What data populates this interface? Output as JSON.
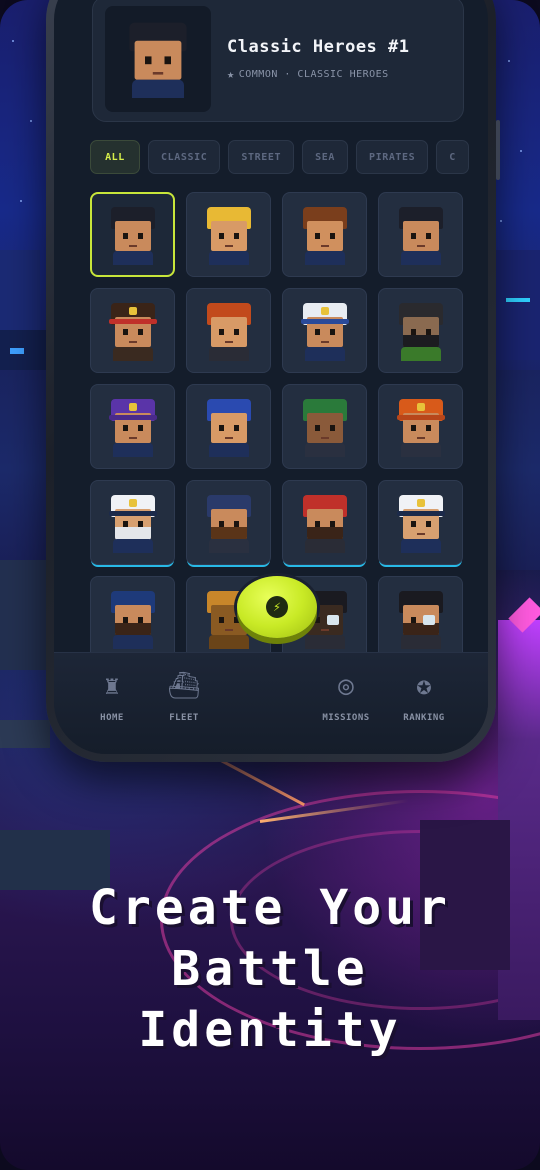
{
  "hero": {
    "title": "Classic Heroes #1",
    "subtitle": "COMMON · CLASSIC HEROES",
    "star_icon": "star-icon"
  },
  "tabs": [
    {
      "label": "ALL",
      "active": true
    },
    {
      "label": "CLASSIC",
      "active": false
    },
    {
      "label": "STREET",
      "active": false
    },
    {
      "label": "SEA",
      "active": false
    },
    {
      "label": "PIRATES",
      "active": false
    },
    {
      "label": "C",
      "active": false
    }
  ],
  "avatars": [
    {
      "name": "avatar-black-hair",
      "hair": "#1c1f2a",
      "skin": "#c98a5c",
      "body": "#1e2f5a",
      "selected": true
    },
    {
      "name": "avatar-blonde",
      "hair": "#e8b934",
      "skin": "#d89a66",
      "body": "#1e2f5a"
    },
    {
      "name": "avatar-brown-hair",
      "hair": "#7a3e1c",
      "skin": "#d0905e",
      "body": "#1e2f5a"
    },
    {
      "name": "avatar-dark-hair",
      "hair": "#1c1f2a",
      "skin": "#c98a5c",
      "body": "#1e2f5a"
    },
    {
      "name": "avatar-red-headband",
      "hair": "#3a2418",
      "skin": "#c98a5c",
      "body": "#3a2a20",
      "brim": "#c0302a"
    },
    {
      "name": "avatar-redhead",
      "hair": "#c24a1c",
      "skin": "#d89a66",
      "body": "#2a2c36"
    },
    {
      "name": "avatar-white-cap",
      "hair": "#e8ecf2",
      "skin": "#c98a5c",
      "body": "#1e2f5a",
      "brim": "#2a4a9a"
    },
    {
      "name": "avatar-masked",
      "hair": "#2a2a2e",
      "skin": "#8a6a50",
      "body": "#3a7a2a",
      "beard": "#1c1c20"
    },
    {
      "name": "avatar-purple-cap",
      "hair": "#5a34a8",
      "skin": "#c98a5c",
      "body": "#1e2f5a",
      "brim": "#4a2a8a"
    },
    {
      "name": "avatar-blue-hair",
      "hair": "#2a4ab0",
      "skin": "#d89a66",
      "body": "#1e2f5a"
    },
    {
      "name": "avatar-green-beanie",
      "hair": "#2a7a3a",
      "skin": "#8a5a3a",
      "body": "#2a3040"
    },
    {
      "name": "avatar-orange-hat",
      "hair": "#d85a1a",
      "skin": "#c98a5c",
      "body": "#2a3040",
      "brim": "#b8461a"
    },
    {
      "name": "avatar-captain-white-beard",
      "hair": "#f0f2f6",
      "skin": "#d8a070",
      "body": "#1e2f5a",
      "beard": "#e4e6ea",
      "brim": "#1c2a4a",
      "glow": true
    },
    {
      "name": "avatar-navy-beanie",
      "hair": "#2a3a6a",
      "skin": "#c98a5c",
      "body": "#2a3040",
      "beard": "#5a3418",
      "glow": true
    },
    {
      "name": "avatar-pirate-red-bandana",
      "hair": "#c0302a",
      "skin": "#c98a5c",
      "body": "#2a2c36",
      "beard": "#3a2418",
      "glow": true
    },
    {
      "name": "avatar-captain-cap",
      "hair": "#f0f2f6",
      "skin": "#d8a070",
      "body": "#1e2f5a",
      "brim": "#1c2a4a",
      "glow": true
    },
    {
      "name": "avatar-navy-officer",
      "hair": "#1e3a7a",
      "skin": "#c98a5c",
      "body": "#1e2f5a",
      "beard": "#3a2418",
      "glow": true
    },
    {
      "name": "avatar-diving-helmet",
      "hair": "#c8862a",
      "skin": "#8a5a22",
      "body": "#6a4418",
      "glow": true
    },
    {
      "name": "avatar-pirate-captain",
      "hair": "#1a1a20",
      "skin": "#3a2a20",
      "body": "#2a2c36",
      "patch": true
    },
    {
      "name": "avatar-pirate-eyepatch",
      "hair": "#1a1a20",
      "skin": "#c98a5c",
      "body": "#2a2c36",
      "beard": "#3a2418",
      "patch": true
    }
  ],
  "nav": [
    {
      "label": "HOME",
      "icon": "castle-icon"
    },
    {
      "label": "FLEET",
      "icon": "ship-icon"
    },
    {
      "label": "MISSIONS",
      "icon": "target-icon"
    },
    {
      "label": "RANKING",
      "icon": "badge-icon"
    }
  ],
  "fab": {
    "icon": "bolt-icon"
  },
  "headline": [
    "Create Your",
    "Battle",
    "Identity"
  ],
  "colors": {
    "accent": "#c9ea26",
    "screen_bg": "#141d2b",
    "cell_bg": "#232e40",
    "glow": "#28b9e6"
  }
}
